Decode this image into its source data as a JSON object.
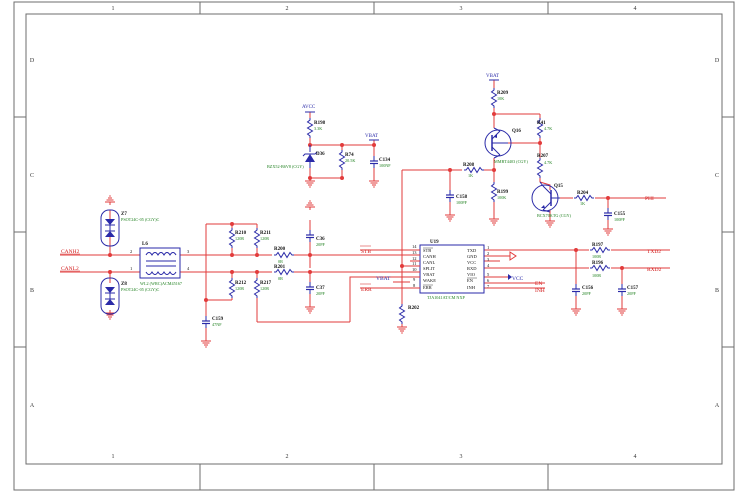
{
  "frame": {
    "zones_top": [
      "1",
      "2",
      "3",
      "4"
    ],
    "zones_bottom": [
      "1",
      "2",
      "3",
      "4"
    ],
    "zones_left": [
      "D",
      "C",
      "B",
      "A"
    ],
    "zones_right": [
      "D",
      "C",
      "B",
      "A"
    ]
  },
  "nets": {
    "canh": "CANH2",
    "canl": "CANL2",
    "stb": "STB",
    "err": "ERR",
    "en": "EN",
    "inh": "INH",
    "txd": "TXD2",
    "rxd": "RXD2",
    "phi": "PHI",
    "vcc": "VCC",
    "vbat_u19": "VBAT"
  },
  "power": {
    "avcc": "AVCC",
    "vbat_d": "VBAT",
    "vbat_q": "VBAT"
  },
  "components": {
    "z7": {
      "ref": "Z7",
      "val": "PSOT24C-05 (CGY)C"
    },
    "z8": {
      "ref": "Z8",
      "val": "PSOT24C-05 (CGY)C"
    },
    "l6": {
      "ref": "L6",
      "val": "WL2 (WRC)ACM45167"
    },
    "r210": {
      "ref": "R210",
      "val": "120R"
    },
    "r211": {
      "ref": "R211",
      "val": "120R"
    },
    "r212": {
      "ref": "R212",
      "val": "120R"
    },
    "r217": {
      "ref": "R217",
      "val": "120R"
    },
    "r200": {
      "ref": "R200",
      "val": "0R"
    },
    "r201": {
      "ref": "R201",
      "val": "0R"
    },
    "c36": {
      "ref": "C36",
      "val": "20PF"
    },
    "c37": {
      "ref": "C37",
      "val": "20PF"
    },
    "c159": {
      "ref": "C159",
      "val": "47NF"
    },
    "r198": {
      "ref": "R198",
      "val": "3.3K"
    },
    "d36": {
      "ref": "D36",
      "val": "BZX52-B6V8 (CGY)"
    },
    "r74": {
      "ref": "R74",
      "val": "20.5K"
    },
    "c134": {
      "ref": "C134",
      "val": "100NF"
    },
    "u19": {
      "ref": "U19",
      "val": "TJA1041AT/CM NXP"
    },
    "r202": {
      "ref": "R202",
      "val": ""
    },
    "r209": {
      "ref": "R209",
      "val": "10K"
    },
    "q16": {
      "ref": "Q16",
      "val": "MMBT4403 (CGY)"
    },
    "r41": {
      "ref": "R41",
      "val": "4.7K"
    },
    "r207": {
      "ref": "R207",
      "val": "4.7K"
    },
    "r208": {
      "ref": "R208",
      "val": "1K"
    },
    "r199": {
      "ref": "R199",
      "val": "100K"
    },
    "c158": {
      "ref": "C158",
      "val": "100PF"
    },
    "q15": {
      "ref": "Q15",
      "val": "BCX70KTG (CGY)"
    },
    "r204": {
      "ref": "R204",
      "val": "1K"
    },
    "c155": {
      "ref": "C155",
      "val": "100PF"
    },
    "r197": {
      "ref": "R197",
      "val": "100R"
    },
    "r196": {
      "ref": "R196",
      "val": "100R"
    },
    "c156": {
      "ref": "C156",
      "val": "20PF"
    },
    "c157": {
      "ref": "C157",
      "val": "20PF"
    }
  },
  "u19_pins": {
    "left": [
      {
        "num": "14",
        "name": "STB"
      },
      {
        "num": "13",
        "name": "CANH"
      },
      {
        "num": "12",
        "name": "CANL"
      },
      {
        "num": "11",
        "name": "SPLIT"
      },
      {
        "num": "10",
        "name": "VBAT"
      },
      {
        "num": "9",
        "name": "WAKE"
      },
      {
        "num": "8",
        "name": "ERR"
      }
    ],
    "right": [
      {
        "num": "1",
        "name": "TXD"
      },
      {
        "num": "2",
        "name": "GND"
      },
      {
        "num": "3",
        "name": "VCC"
      },
      {
        "num": "4",
        "name": "RXD"
      },
      {
        "num": "5",
        "name": "VIO"
      },
      {
        "num": "6",
        "name": "EN"
      },
      {
        "num": "7",
        "name": "INH"
      }
    ]
  },
  "l6_pins": [
    "2",
    "1",
    "3",
    "4"
  ]
}
